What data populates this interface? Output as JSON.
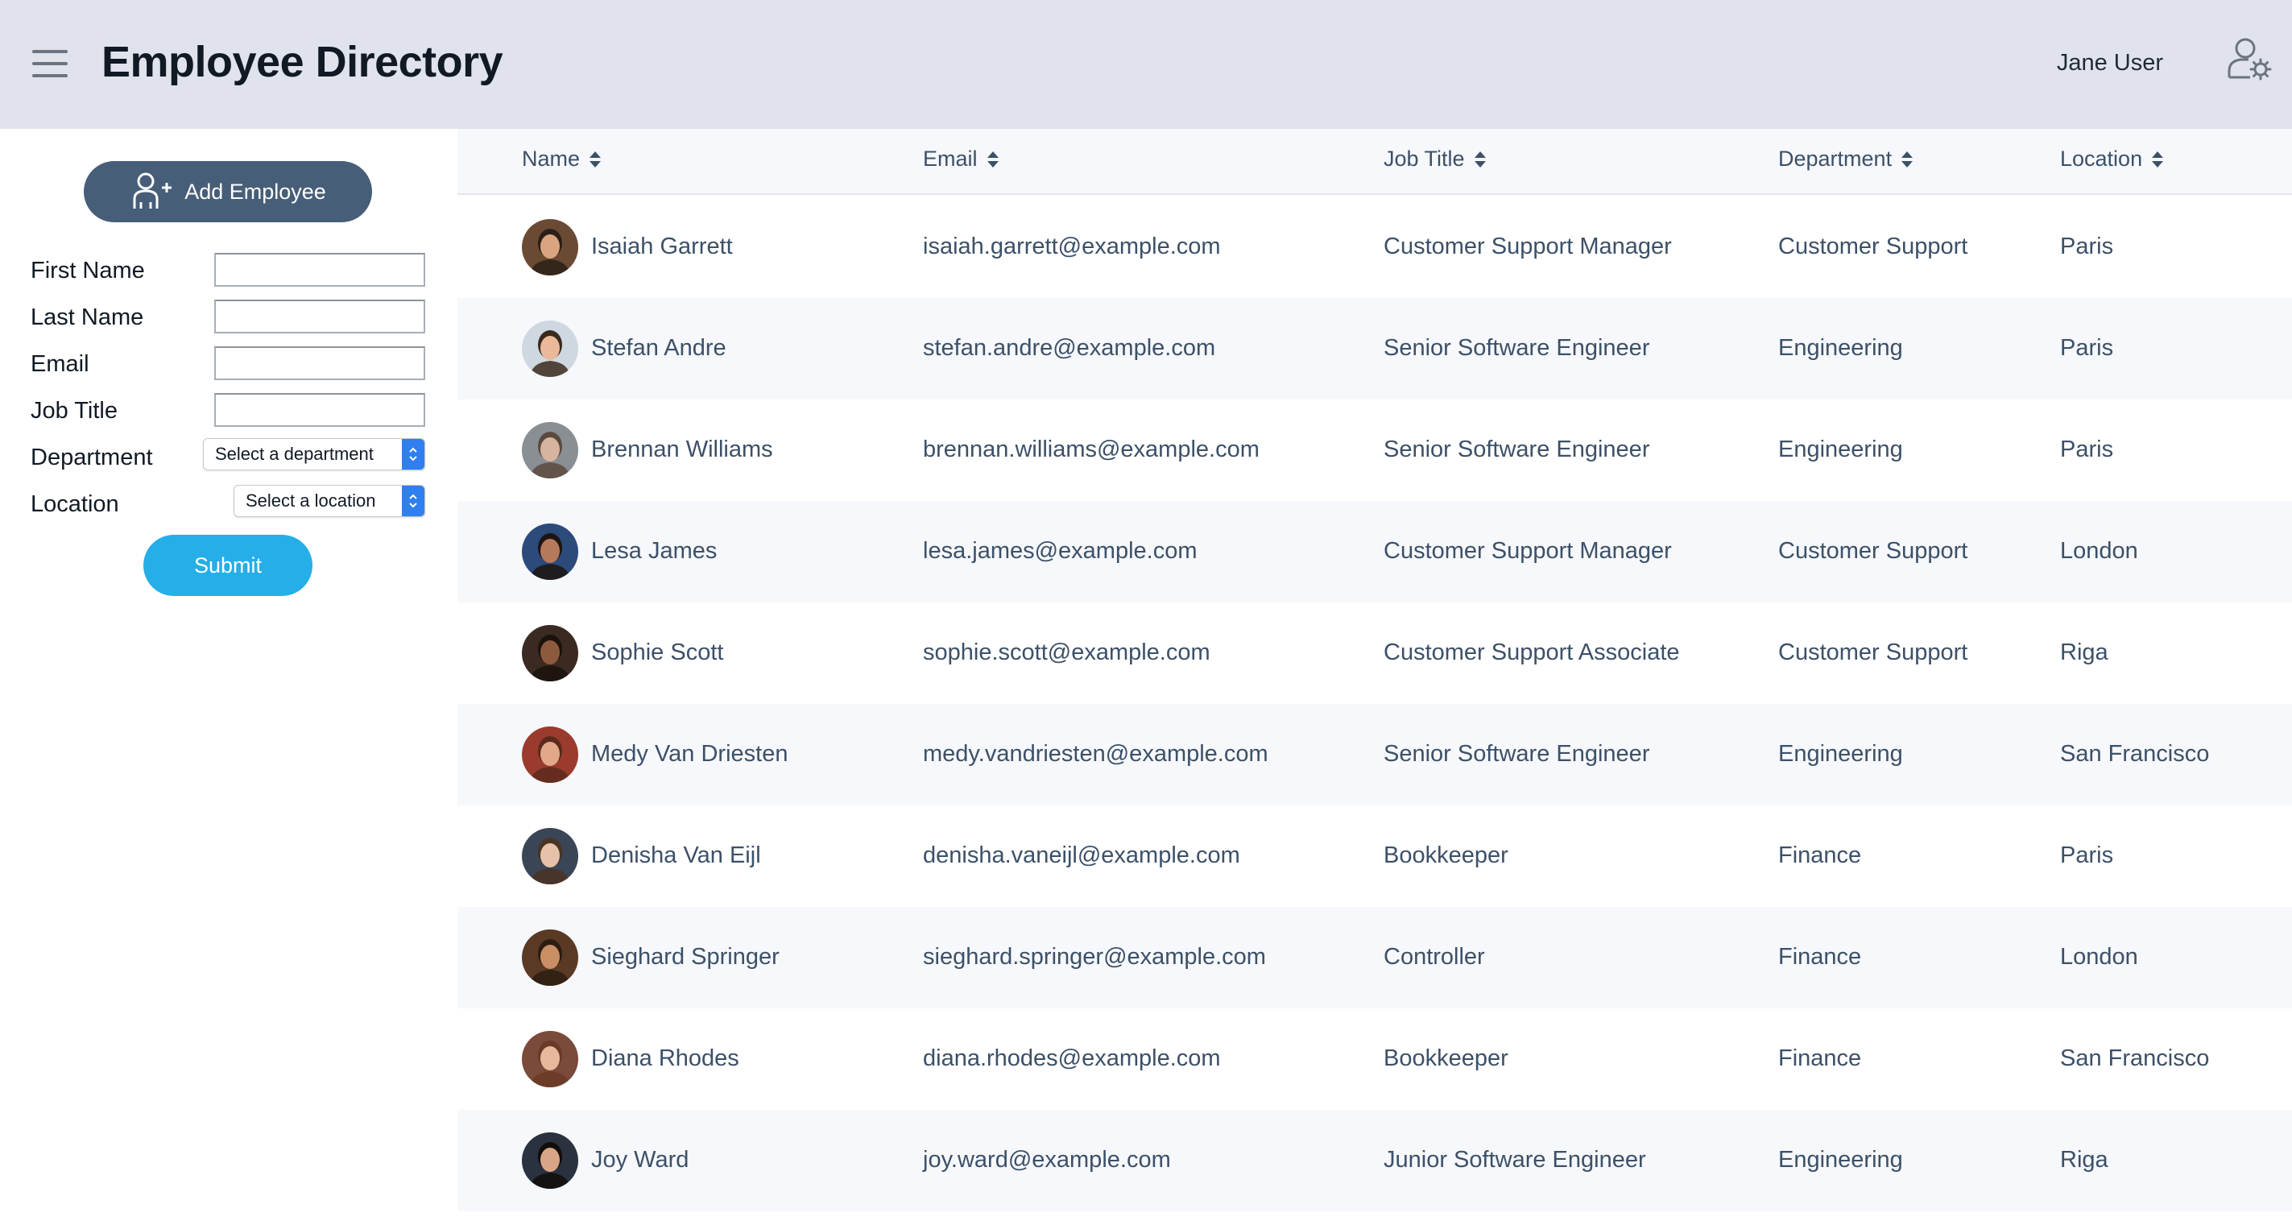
{
  "header": {
    "title": "Employee Directory",
    "user_name": "Jane User",
    "menu_icon": "hamburger-menu-icon",
    "user_icon": "user-settings-icon"
  },
  "sidebar": {
    "add_button_label": "Add Employee",
    "add_button_icon": "add-user-icon",
    "form": {
      "first_name_label": "First Name",
      "first_name_value": "",
      "last_name_label": "Last Name",
      "last_name_value": "",
      "email_label": "Email",
      "email_value": "",
      "job_title_label": "Job Title",
      "job_title_value": "",
      "department_label": "Department",
      "department_selected": "Select a department",
      "location_label": "Location",
      "location_selected": "Select a location",
      "submit_label": "Submit"
    }
  },
  "table": {
    "columns": [
      "Name",
      "Email",
      "Job Title",
      "Department",
      "Location"
    ],
    "sort_icon": "sort-icon",
    "rows": [
      {
        "name": "Isaiah Garrett",
        "email": "isaiah.garrett@example.com",
        "job_title": "Customer Support Manager",
        "department": "Customer Support",
        "location": "Paris"
      },
      {
        "name": "Stefan Andre",
        "email": "stefan.andre@example.com",
        "job_title": "Senior Software Engineer",
        "department": "Engineering",
        "location": "Paris"
      },
      {
        "name": "Brennan Williams",
        "email": "brennan.williams@example.com",
        "job_title": "Senior Software Engineer",
        "department": "Engineering",
        "location": "Paris"
      },
      {
        "name": "Lesa James",
        "email": "lesa.james@example.com",
        "job_title": "Customer Support Manager",
        "department": "Customer Support",
        "location": "London"
      },
      {
        "name": "Sophie Scott",
        "email": "sophie.scott@example.com",
        "job_title": "Customer Support Associate",
        "department": "Customer Support",
        "location": "Riga"
      },
      {
        "name": "Medy Van Driesten",
        "email": "medy.vandriesten@example.com",
        "job_title": "Senior Software Engineer",
        "department": "Engineering",
        "location": "San Francisco"
      },
      {
        "name": "Denisha Van Eijl",
        "email": "denisha.vaneijl@example.com",
        "job_title": "Bookkeeper",
        "department": "Finance",
        "location": "Paris"
      },
      {
        "name": "Sieghard Springer",
        "email": "sieghard.springer@example.com",
        "job_title": "Controller",
        "department": "Finance",
        "location": "London"
      },
      {
        "name": "Diana Rhodes",
        "email": "diana.rhodes@example.com",
        "job_title": "Bookkeeper",
        "department": "Finance",
        "location": "San Francisco"
      },
      {
        "name": "Joy Ward",
        "email": "joy.ward@example.com",
        "job_title": "Junior Software Engineer",
        "department": "Engineering",
        "location": "Riga"
      }
    ]
  },
  "colors": {
    "header_bg": "#e1e3ec",
    "add_button": "#475e78",
    "submit_button": "#25aee8",
    "table_text": "#3c5068",
    "row_alt": "#f6f8fb"
  }
}
